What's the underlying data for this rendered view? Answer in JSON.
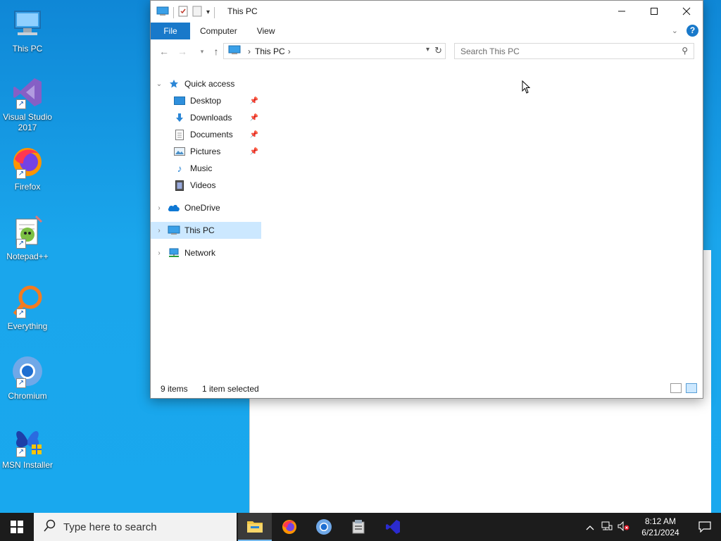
{
  "desktop": {
    "icons": [
      {
        "label": "This PC"
      },
      {
        "label": "Visual Studio\n2017"
      },
      {
        "label": "Firefox"
      },
      {
        "label": "Notepad++"
      },
      {
        "label": "Everything"
      },
      {
        "label": "Chromium"
      },
      {
        "label": "MSN Installer"
      }
    ]
  },
  "explorer": {
    "title": "This PC",
    "tabs": {
      "file": "File",
      "computer": "Computer",
      "view": "View"
    },
    "address": {
      "crumb": "This PC"
    },
    "search": {
      "placeholder": "Search This PC"
    },
    "nav": {
      "quick_access": "Quick access",
      "desktop": "Desktop",
      "downloads": "Downloads",
      "documents": "Documents",
      "pictures": "Pictures",
      "music": "Music",
      "videos": "Videos",
      "onedrive": "OneDrive",
      "this_pc": "This PC",
      "network": "Network"
    },
    "status": {
      "count": "9 items",
      "selection": "1 item selected"
    }
  },
  "taskbar": {
    "search_placeholder": "Type here to search",
    "time": "8:12 AM",
    "date": "6/21/2024"
  },
  "colors": {
    "accent": "#1979ca",
    "selection": "#cce8ff",
    "taskbar": "#1c1c1c"
  }
}
